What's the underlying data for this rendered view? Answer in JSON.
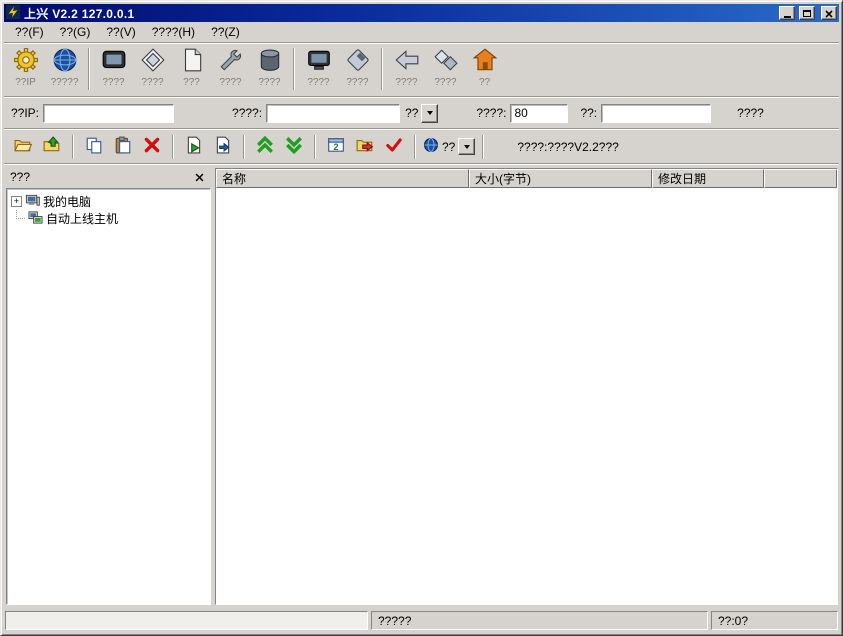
{
  "window": {
    "title": "上兴 V2.2   127.0.0.1"
  },
  "menu": {
    "items": [
      {
        "label": "??(F)"
      },
      {
        "label": "??(G)"
      },
      {
        "label": "??(V)"
      },
      {
        "label": "????(H)"
      },
      {
        "label": "??(Z)"
      }
    ]
  },
  "toolbar": {
    "buttons": [
      {
        "label": "??IP",
        "icon": "gear-icon"
      },
      {
        "label": "?????",
        "icon": "globe-icon"
      },
      {
        "label": "????",
        "icon": "screen-capture-icon"
      },
      {
        "label": "????",
        "icon": "diamond-icon"
      },
      {
        "label": "???",
        "icon": "document-icon"
      },
      {
        "label": "????",
        "icon": "wrench-icon"
      },
      {
        "label": "????",
        "icon": "database-icon"
      },
      {
        "label": "????",
        "icon": "monitor-icon"
      },
      {
        "label": "????",
        "icon": "floppy-icon"
      },
      {
        "label": "????",
        "icon": "back-arrow-icon"
      },
      {
        "label": "????",
        "icon": "transfer-icon"
      },
      {
        "label": "??",
        "icon": "home-icon"
      }
    ]
  },
  "connect_bar": {
    "ip_label": "??IP:",
    "ip_value": "",
    "target_label": "????:",
    "target_value": "",
    "protocol_combo_label": "??",
    "port_label": "????:",
    "port_value": "80",
    "password_label": "??:",
    "password_value": "",
    "connect_label": "????"
  },
  "file_toolbar": {
    "encoding_combo_label": "??",
    "status_text": "????:????V2.2???"
  },
  "sidebar": {
    "title": "???",
    "tree": [
      {
        "expander": "+",
        "label": "我的电脑"
      },
      {
        "label": "自动上线主机"
      }
    ]
  },
  "file_list": {
    "columns": [
      {
        "label": "名称"
      },
      {
        "label": "大小(字节)"
      },
      {
        "label": "修改日期"
      }
    ],
    "rows": []
  },
  "status_bar": {
    "left": "",
    "middle": "?????",
    "right": "??:0?"
  }
}
